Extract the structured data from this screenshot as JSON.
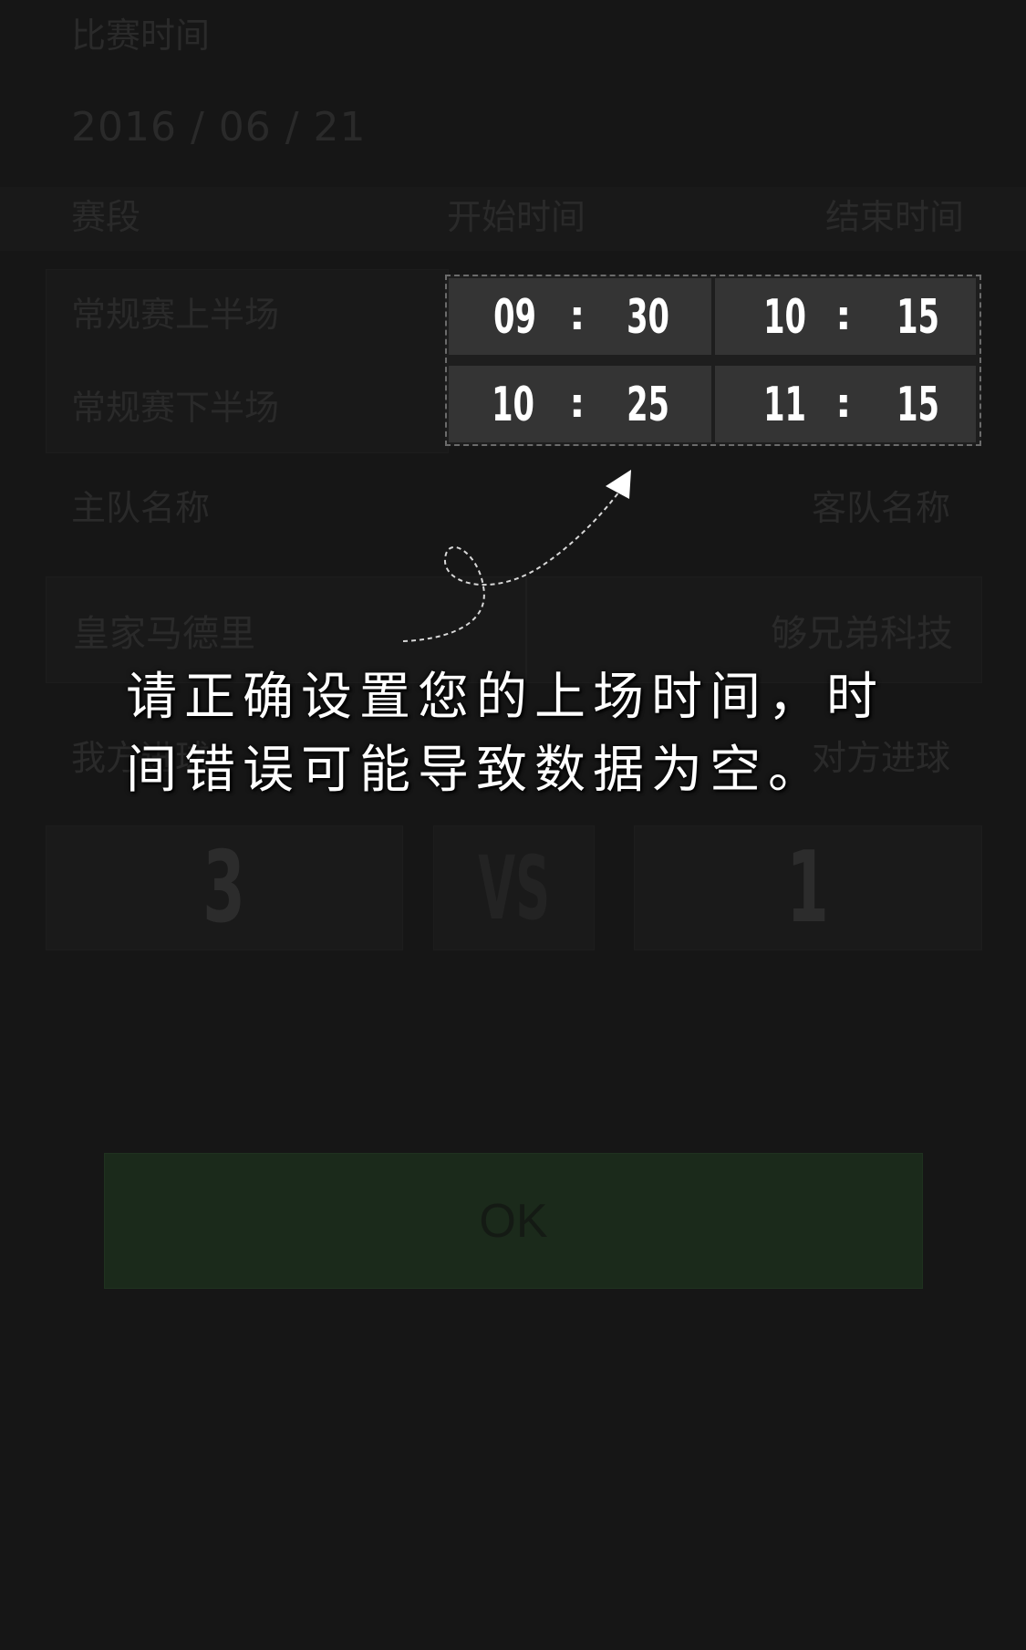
{
  "form": {
    "match_time_label": "比赛时间",
    "match_date": "2016 / 06 / 21",
    "columns": {
      "period": "赛段",
      "start_time": "开始时间",
      "end_time": "结束时间"
    },
    "periods": [
      {
        "label": "常规赛上半场",
        "start_hour": "09",
        "start_minute": "30",
        "end_hour": "10",
        "end_minute": "15"
      },
      {
        "label": "常规赛下半场",
        "start_hour": "10",
        "start_minute": "25",
        "end_hour": "11",
        "end_minute": "15"
      }
    ],
    "time_separator": ":",
    "home_team_label": "主队名称",
    "away_team_label": "客队名称",
    "home_team": "皇家马德里",
    "away_team": "够兄弟科技",
    "our_goals_label": "我方进球",
    "their_goals_label": "对方进球",
    "our_score": "3",
    "vs_label": "VS",
    "their_score": "1"
  },
  "hint": {
    "line1": "请正确设置您的上场时间，时",
    "line2": "间错误可能导致数据为空。"
  },
  "ok_button": {
    "label": "OK"
  }
}
